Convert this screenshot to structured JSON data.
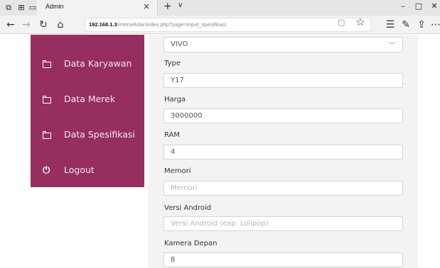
{
  "browser": {
    "tab_title": "Admin",
    "close_glyph": "×",
    "new_tab_glyph": "+",
    "tab_dropdown_glyph": "∨",
    "url_host": "192.168.1.3",
    "url_path": "/interselular/index.php?page=input_spesifikasi",
    "icons": [
      "tab-actions-icon",
      "set-aside-tabs-icon",
      "tab-page-icon",
      "back-icon",
      "forward-icon",
      "refresh-icon",
      "home-icon",
      "reading-view-icon",
      "favorite-star-icon",
      "favorites-hub-icon",
      "pen-icon",
      "share-icon",
      "more-icon",
      "minimize-icon",
      "maximize-icon",
      "close-window-icon"
    ]
  },
  "sidebar": {
    "background": "#962e60",
    "items": [
      {
        "label": "Data Karyawan",
        "icon": "folder-icon"
      },
      {
        "label": "Data Merek",
        "icon": "folder-icon"
      },
      {
        "label": "Data Spesifikasi",
        "icon": "folder-icon"
      },
      {
        "label": "Logout",
        "icon": "power-icon"
      }
    ]
  },
  "form": {
    "brand_select": {
      "value": "VIVO"
    },
    "fields": [
      {
        "label": "Type",
        "value": "Y17",
        "placeholder": ""
      },
      {
        "label": "Harga",
        "value": "3000000",
        "placeholder": ""
      },
      {
        "label": "RAM",
        "value": "4",
        "placeholder": ""
      },
      {
        "label": "Memori",
        "value": "",
        "placeholder": "Memori"
      },
      {
        "label": "Versi Android",
        "value": "",
        "placeholder": "Versi Android (exp. Lolipop)"
      },
      {
        "label": "Kamera Depan",
        "value": "8",
        "placeholder": ""
      }
    ]
  }
}
